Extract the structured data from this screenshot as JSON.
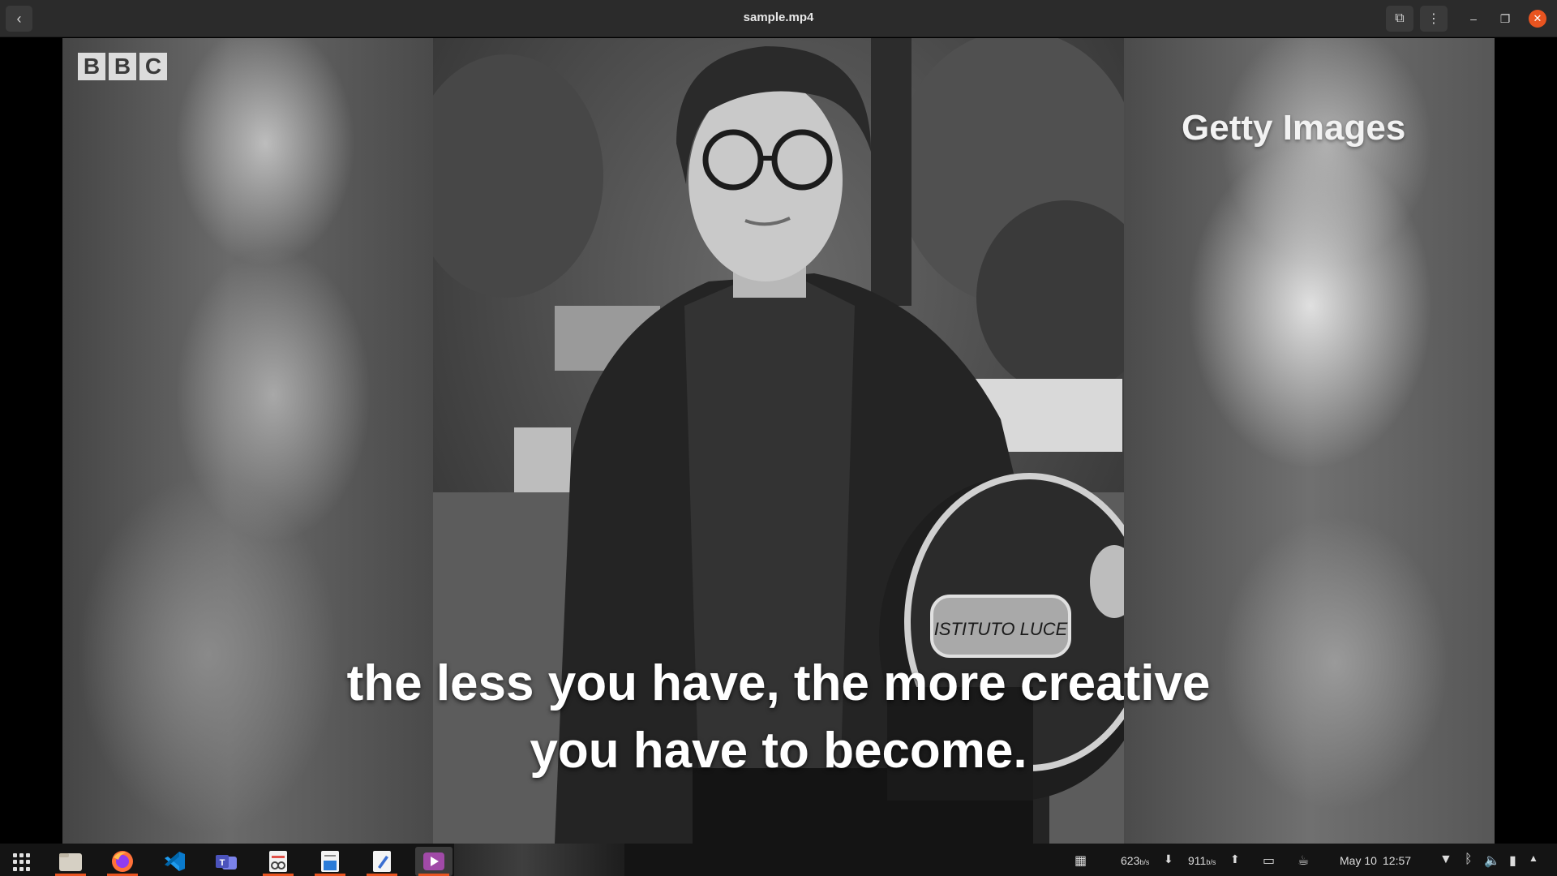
{
  "window": {
    "title": "sample.mp4",
    "back_icon": "‹",
    "pip_icon": "⧉",
    "menu_icon": "⋮",
    "minimize_icon": "–",
    "restore_icon": "❐",
    "close_icon": "✕"
  },
  "video": {
    "bbc_letters": [
      "B",
      "B",
      "C"
    ],
    "watermark": "Getty Images",
    "subtitle_line1": "the less you have, the more creative",
    "subtitle_line2": "you have to become.",
    "camera_label": "ISTITUTO LUCE"
  },
  "taskbar": {
    "apps": [
      {
        "name": "files",
        "running": true
      },
      {
        "name": "firefox",
        "running": true
      },
      {
        "name": "vscode",
        "running": false
      },
      {
        "name": "teams",
        "running": false
      },
      {
        "name": "document-viewer",
        "running": true
      },
      {
        "name": "libreoffice-writer",
        "running": true
      },
      {
        "name": "text-editor",
        "running": true
      },
      {
        "name": "video-player",
        "running": true
      }
    ],
    "net_down_value": "623",
    "net_down_unit": "b/s",
    "net_up_value": "911",
    "net_up_unit": "b/s",
    "date": "May 10",
    "time": "12:57"
  },
  "colors": {
    "accent": "#e95420",
    "titlebar": "#2b2b2b",
    "taskbar": "#141414"
  }
}
